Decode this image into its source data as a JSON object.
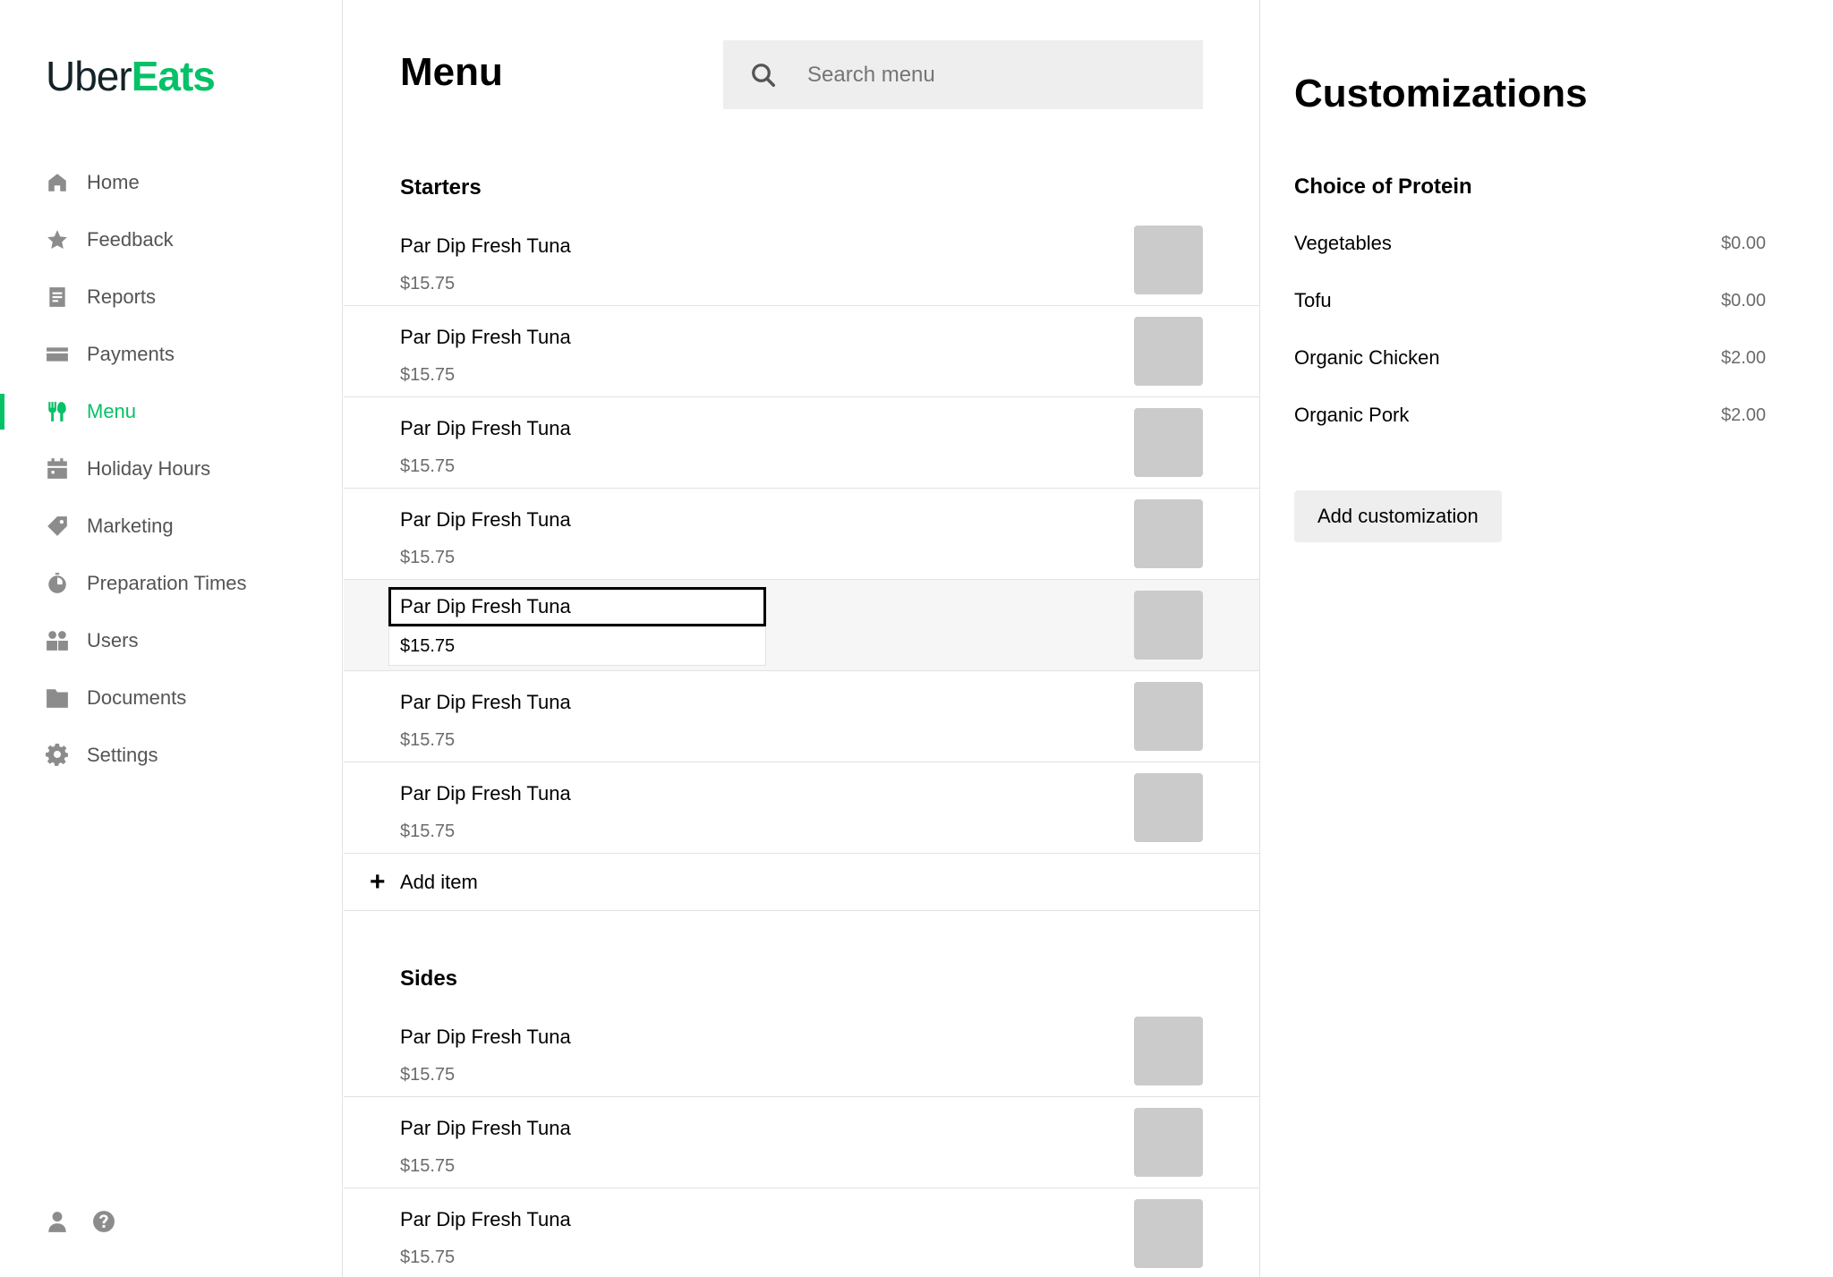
{
  "brand": {
    "part1": "Uber",
    "part2": "Eats",
    "color": "#06c167"
  },
  "sidebar": {
    "items": [
      {
        "label": "Home",
        "icon": "home-icon"
      },
      {
        "label": "Feedback",
        "icon": "star-icon"
      },
      {
        "label": "Reports",
        "icon": "report-icon"
      },
      {
        "label": "Payments",
        "icon": "card-icon"
      },
      {
        "label": "Menu",
        "icon": "utensils-icon",
        "active": true
      },
      {
        "label": "Holiday Hours",
        "icon": "calendar-icon"
      },
      {
        "label": "Marketing",
        "icon": "tag-icon"
      },
      {
        "label": "Preparation Times",
        "icon": "timer-icon"
      },
      {
        "label": "Users",
        "icon": "users-icon"
      },
      {
        "label": "Documents",
        "icon": "folder-icon"
      },
      {
        "label": "Settings",
        "icon": "gear-icon"
      }
    ],
    "footer_icons": [
      "user-icon",
      "help-icon"
    ]
  },
  "main": {
    "title": "Menu",
    "search_placeholder": "Search menu",
    "sections": [
      {
        "title": "Starters",
        "items": [
          {
            "name": "Par Dip Fresh Tuna",
            "price": "$15.75"
          },
          {
            "name": "Par Dip Fresh Tuna",
            "price": "$15.75"
          },
          {
            "name": "Par Dip Fresh Tuna",
            "price": "$15.75"
          },
          {
            "name": "Par Dip Fresh Tuna",
            "price": "$15.75"
          },
          {
            "name": "Par Dip Fresh Tuna",
            "price": "$15.75",
            "editing": true
          },
          {
            "name": "Par Dip Fresh Tuna",
            "price": "$15.75"
          },
          {
            "name": "Par Dip Fresh Tuna",
            "price": "$15.75"
          }
        ],
        "add_label": "Add item"
      },
      {
        "title": "Sides",
        "items": [
          {
            "name": "Par Dip Fresh Tuna",
            "price": "$15.75"
          },
          {
            "name": "Par Dip Fresh Tuna",
            "price": "$15.75"
          },
          {
            "name": "Par Dip Fresh Tuna",
            "price": "$15.75"
          }
        ]
      }
    ]
  },
  "customizations": {
    "title": "Customizations",
    "group_title": "Choice of Protein",
    "options": [
      {
        "name": "Vegetables",
        "price": "$0.00"
      },
      {
        "name": "Tofu",
        "price": "$0.00"
      },
      {
        "name": "Organic Chicken",
        "price": "$2.00"
      },
      {
        "name": "Organic Pork",
        "price": "$2.00"
      }
    ],
    "add_button": "Add customization"
  }
}
